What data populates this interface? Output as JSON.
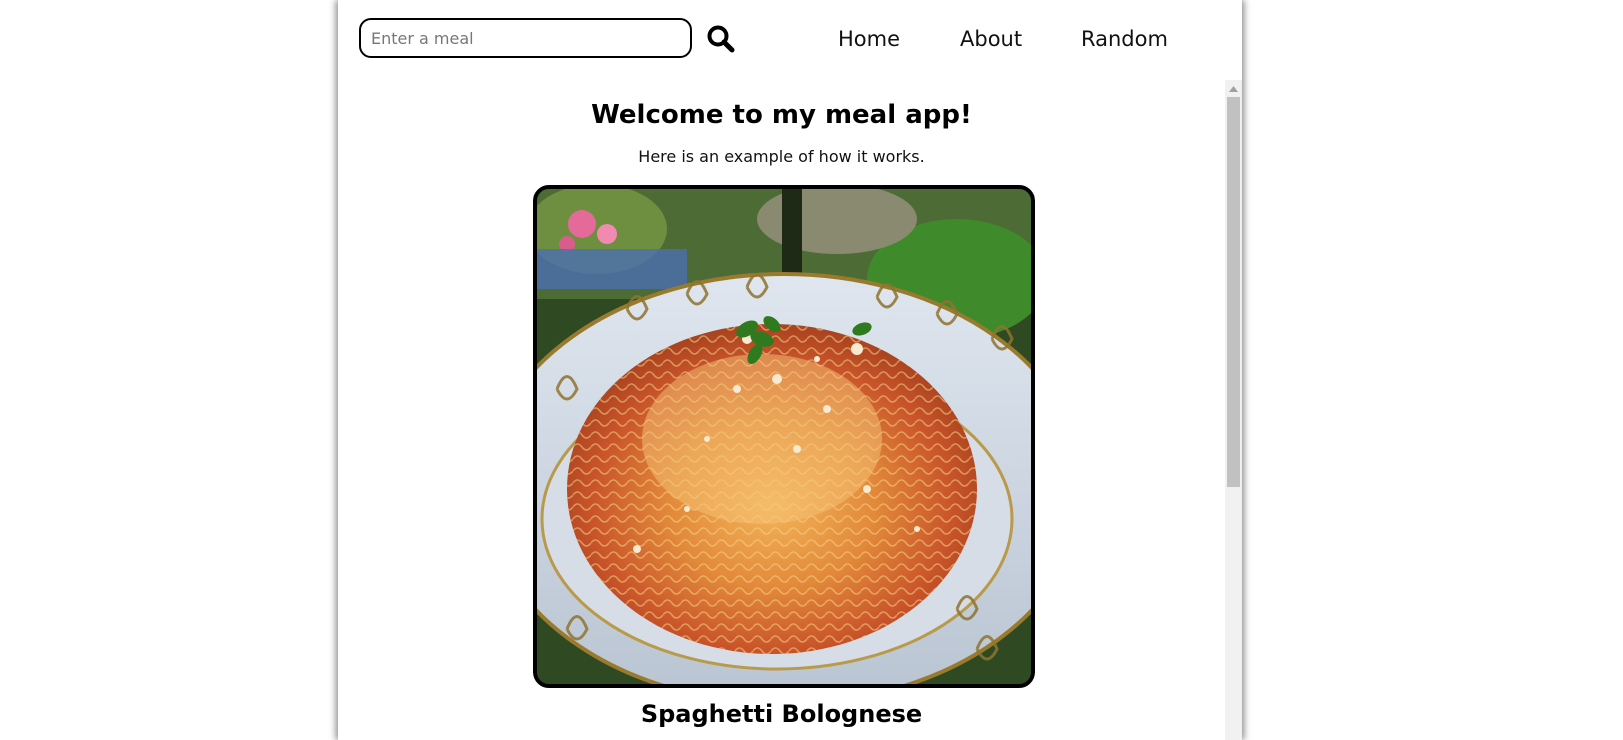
{
  "header": {
    "search": {
      "placeholder": "Enter a meal",
      "value": ""
    },
    "search_button_icon": "magnifier-icon",
    "nav": [
      {
        "label": "Home"
      },
      {
        "label": "About"
      },
      {
        "label": "Random"
      }
    ]
  },
  "main": {
    "title": "Welcome to my meal app!",
    "subtitle": "Here is an example of how it works.",
    "meal": {
      "name": "Spaghetti Bolognese",
      "image_icon": "spaghetti-bolognese-photo"
    }
  },
  "scrollbar": {
    "up_arrow_icon": "scroll-up-arrow-icon",
    "scroll_position": 0
  },
  "colors": {
    "text": "#000000",
    "frame_background": "#ffffff",
    "border": "#000000",
    "scroll_track": "#f1f1f1",
    "scroll_thumb": "#c1c1c1"
  }
}
